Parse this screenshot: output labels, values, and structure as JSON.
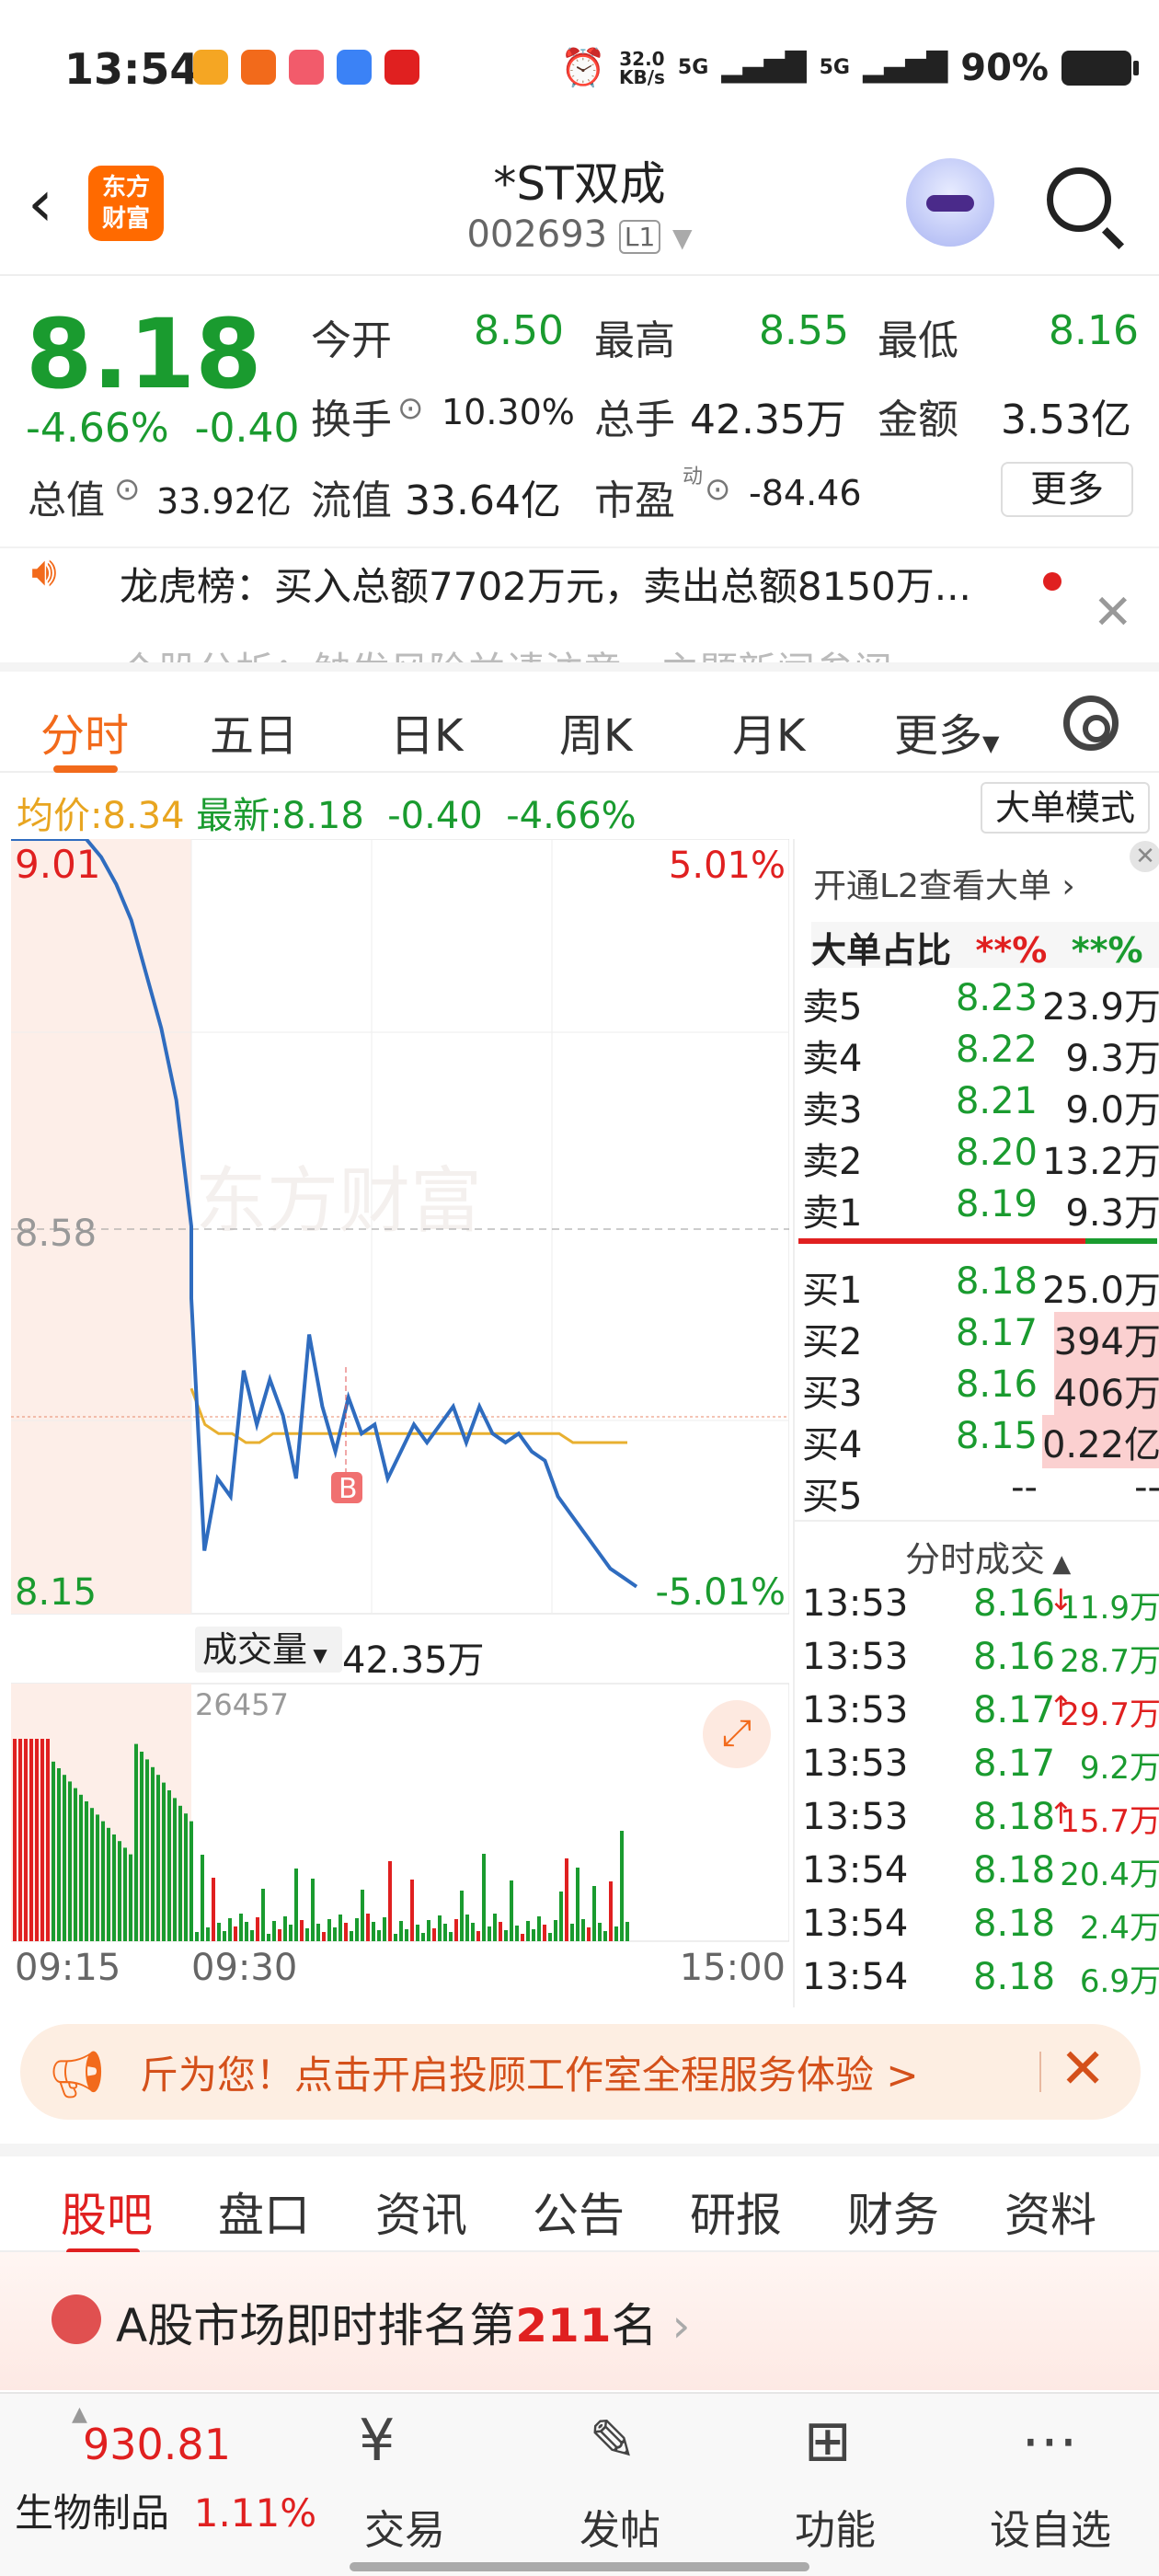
{
  "status_bar": {
    "time": "13:54",
    "net_speed_top": "32.0",
    "net_speed_unit": "KB/s",
    "sig1": "5G",
    "sig2": "5G",
    "battery": "90%"
  },
  "header": {
    "logo_line1": "东方",
    "logo_line2": "财富",
    "stock_name": "*ST双成",
    "stock_code": "002693",
    "level": "L1"
  },
  "quote": {
    "price": "8.18",
    "change_pct": "-4.66%",
    "change": "-0.40",
    "open_label": "今开",
    "open": "8.50",
    "high_label": "最高",
    "high": "8.55",
    "low_label": "最低",
    "low": "8.16",
    "turnover_label": "换手",
    "turnover": "10.30%",
    "volume_label": "总手",
    "volume": "42.35万",
    "amount_label": "金额",
    "amount": "3.53亿",
    "mktcap_label": "总值",
    "mktcap": "33.92亿",
    "float_label": "流值",
    "float": "33.64亿",
    "pe_label": "市盈",
    "pe_sup": "动",
    "pe": "-84.46",
    "more": "更多"
  },
  "news": {
    "line1": "龙虎榜：买入总额7702万元，卖出总额8150万...",
    "line2": "个股分析：触发风险并请注意，主题新闻参阅"
  },
  "kline_tabs": [
    "分时",
    "五日",
    "日K",
    "周K",
    "月K",
    "更多"
  ],
  "avg_row": {
    "avg_label": "均价:",
    "avg": "8.34",
    "latest_label": "最新:",
    "latest": "8.18",
    "change": "-0.40",
    "pct": "-4.66%",
    "big_mode": "大单模式"
  },
  "chart_data": {
    "type": "line",
    "y_high": "9.01",
    "y_mid": "8.58",
    "y_low": "8.15",
    "pct_high": "5.01%",
    "pct_low": "-5.01%",
    "ylim": [
      8.15,
      9.01
    ],
    "prev_close": 8.58,
    "avg_price": 8.34,
    "watermark": "东方财富",
    "marker": "B",
    "volume_label": "成交量",
    "volume_total": "42.35万",
    "volume_max": "26457",
    "x_labels": [
      "09:15",
      "09:30",
      "15:00"
    ],
    "price_series": [
      9.01,
      9.01,
      9.01,
      9.01,
      9.01,
      9.01,
      8.99,
      8.96,
      8.92,
      8.86,
      8.8,
      8.72,
      8.58,
      8.5,
      8.22,
      8.3,
      8.28,
      8.42,
      8.36,
      8.41,
      8.37,
      8.3,
      8.46,
      8.38,
      8.33,
      8.39,
      8.35,
      8.36,
      8.3,
      8.33,
      8.36,
      8.34,
      8.36,
      8.38,
      8.34,
      8.38,
      8.35,
      8.34,
      8.35,
      8.33,
      8.32,
      8.28,
      8.26,
      8.24,
      8.22,
      8.2,
      8.19,
      8.18
    ],
    "avg_series": [
      8.4,
      8.36,
      8.35,
      8.35,
      8.34,
      8.34,
      8.35,
      8.35,
      8.35,
      8.35,
      8.35,
      8.35,
      8.35,
      8.35,
      8.35,
      8.35,
      8.35,
      8.35,
      8.35,
      8.35,
      8.35,
      8.35,
      8.35,
      8.35,
      8.35,
      8.35,
      8.35,
      8.35,
      8.34,
      8.34,
      8.34,
      8.34,
      8.34
    ]
  },
  "book": {
    "l2_hint": "开通L2查看大单 ›",
    "ratio_label": "大单占比",
    "ratio_red": "**%",
    "ratio_green": "**%",
    "asks": [
      {
        "label": "卖5",
        "price": "8.23",
        "vol": "23.9万"
      },
      {
        "label": "卖4",
        "price": "8.22",
        "vol": "9.3万"
      },
      {
        "label": "卖3",
        "price": "8.21",
        "vol": "9.0万"
      },
      {
        "label": "卖2",
        "price": "8.20",
        "vol": "13.2万"
      },
      {
        "label": "卖1",
        "price": "8.19",
        "vol": "9.3万"
      }
    ],
    "bids": [
      {
        "label": "买1",
        "price": "8.18",
        "vol": "25.0万"
      },
      {
        "label": "买2",
        "price": "8.17",
        "vol": "394万"
      },
      {
        "label": "买3",
        "price": "8.16",
        "vol": "406万"
      },
      {
        "label": "买4",
        "price": "8.15",
        "vol": "0.22亿"
      },
      {
        "label": "买5",
        "price": "--",
        "vol": "--"
      }
    ],
    "ticks_label": "分时成交",
    "ticks": [
      {
        "t": "13:53",
        "p": "8.16",
        "d": "↓",
        "v": "11.9万",
        "c": "green"
      },
      {
        "t": "13:53",
        "p": "8.16",
        "d": "",
        "v": "28.7万",
        "c": "green"
      },
      {
        "t": "13:53",
        "p": "8.17",
        "d": "↑",
        "v": "29.7万",
        "c": "red"
      },
      {
        "t": "13:53",
        "p": "8.17",
        "d": "",
        "v": "9.2万",
        "c": "green"
      },
      {
        "t": "13:53",
        "p": "8.18",
        "d": "↑",
        "v": "15.7万",
        "c": "red"
      },
      {
        "t": "13:54",
        "p": "8.18",
        "d": "",
        "v": "20.4万",
        "c": "green"
      },
      {
        "t": "13:54",
        "p": "8.18",
        "d": "",
        "v": "2.4万",
        "c": "green"
      },
      {
        "t": "13:54",
        "p": "8.18",
        "d": "",
        "v": "6.9万",
        "c": "green"
      }
    ]
  },
  "ad": {
    "text": "斤为您！点击开启投顾工作室全程服务体验 >"
  },
  "bottom_tabs": [
    "股吧",
    "盘口",
    "资讯",
    "公告",
    "研报",
    "财务",
    "资料"
  ],
  "rank": {
    "prefix": "A股市场即时排名第",
    "num": "211",
    "suffix": "名"
  },
  "nav": {
    "sector_price": "930.81",
    "sector_name": "生物制品",
    "sector_pct": "1.11%",
    "trade": "交易",
    "post": "发帖",
    "func": "功能",
    "watch": "设自选"
  }
}
